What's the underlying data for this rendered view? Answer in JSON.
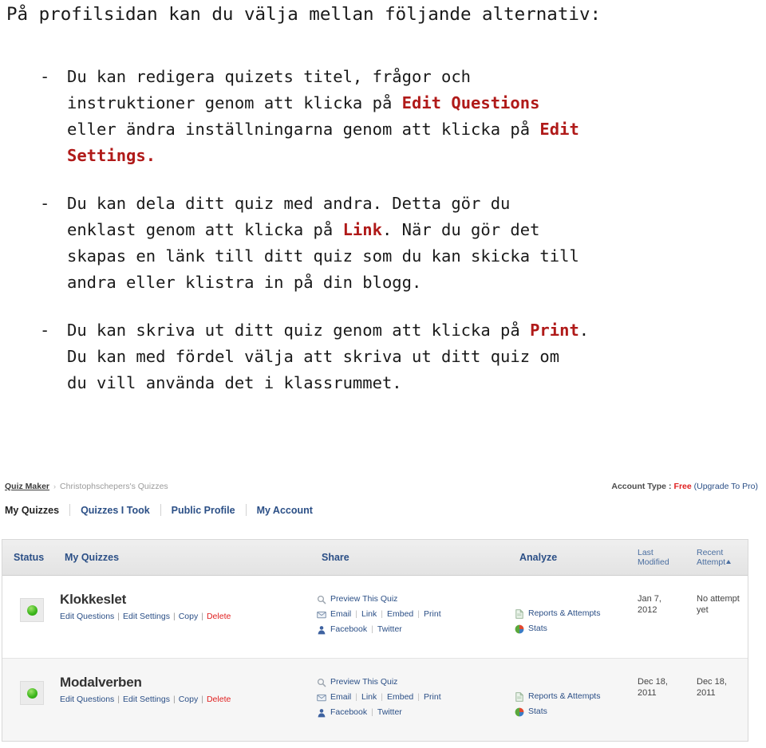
{
  "document": {
    "heading": "På profilsidan kan du välja mellan följande alternativ:",
    "bullets": [
      {
        "marker": "-",
        "lines": [
          [
            {
              "t": "Du kan redigera quizets titel, frågor och",
              "kw": false
            }
          ],
          [
            {
              "t": "instruktioner genom att klicka på ",
              "kw": false
            },
            {
              "t": "Edit Questions",
              "kw": true
            }
          ],
          [
            {
              "t": "eller ändra inställningarna genom att klicka på ",
              "kw": false
            },
            {
              "t": "Edit",
              "kw": true
            }
          ],
          [
            {
              "t": "Settings.",
              "kw": true
            }
          ]
        ]
      },
      {
        "marker": "-",
        "lines": [
          [
            {
              "t": "Du kan dela ditt quiz med andra. Detta gör du",
              "kw": false
            }
          ],
          [
            {
              "t": "enklast genom att klicka på ",
              "kw": false
            },
            {
              "t": "Link",
              "kw": true
            },
            {
              "t": ". När du gör det",
              "kw": false
            }
          ],
          [
            {
              "t": "skapas en länk till ditt quiz som du kan skicka till",
              "kw": false
            }
          ],
          [
            {
              "t": "andra eller klistra in på din blogg.",
              "kw": false
            }
          ]
        ]
      },
      {
        "marker": "-",
        "lines": [
          [
            {
              "t": "Du kan skriva ut ditt quiz genom att klicka på ",
              "kw": false
            },
            {
              "t": "Print",
              "kw": true
            },
            {
              "t": ".",
              "kw": false
            }
          ],
          [
            {
              "t": "Du kan med fördel välja att skriva ut ditt quiz om",
              "kw": false
            }
          ],
          [
            {
              "t": "du vill använda det i klassrummet.",
              "kw": false
            }
          ]
        ]
      }
    ]
  },
  "screenshot": {
    "breadcrumb": {
      "root": "Quiz Maker",
      "separator": "›",
      "current": "Christophschepers's Quizzes"
    },
    "account": {
      "label": "Account Type",
      "colon": ":",
      "plan": "Free",
      "upgrade": "(Upgrade To Pro)"
    },
    "tabs": [
      {
        "label": "My Quizzes",
        "active": true
      },
      {
        "label": "Quizzes I Took",
        "active": false
      },
      {
        "label": "Public Profile",
        "active": false
      },
      {
        "label": "My Account",
        "active": false
      }
    ],
    "table": {
      "headers": {
        "status": "Status",
        "name": "My Quizzes",
        "share": "Share",
        "analyze": "Analyze",
        "modified": "Last Modified",
        "modified_l1": "Last",
        "modified_l2": "Modified",
        "attempt": "Recent Attempt",
        "attempt_l1": "Recent",
        "attempt_l2": "Attempt",
        "sort_indicator": "ascending"
      },
      "row_actions": {
        "edit_questions": "Edit Questions",
        "edit_settings": "Edit Settings",
        "copy": "Copy",
        "delete": "Delete",
        "separator": "|"
      },
      "share_actions": {
        "preview": "Preview This Quiz",
        "email": "Email",
        "link": "Link",
        "embed": "Embed",
        "print": "Print",
        "facebook": "Facebook",
        "twitter": "Twitter",
        "separator": "|"
      },
      "analyze_actions": {
        "reports": "Reports & Attempts",
        "stats": "Stats"
      },
      "rows": [
        {
          "status": "active",
          "name": "Klokkeslet",
          "modified_l1": "Jan 7,",
          "modified_l2": "2012",
          "attempt_l1": "No attempt",
          "attempt_l2": "yet"
        },
        {
          "status": "active",
          "name": "Modalverben",
          "modified_l1": "Dec 18,",
          "modified_l2": "2011",
          "attempt_l1": "Dec 18,",
          "attempt_l2": "2011"
        }
      ]
    },
    "colors": {
      "link": "#2b4f86",
      "danger": "#e02020",
      "keyword_red": "#b01a19",
      "status_green": "#3fb81e",
      "header_band": "#e7e7e7"
    }
  }
}
